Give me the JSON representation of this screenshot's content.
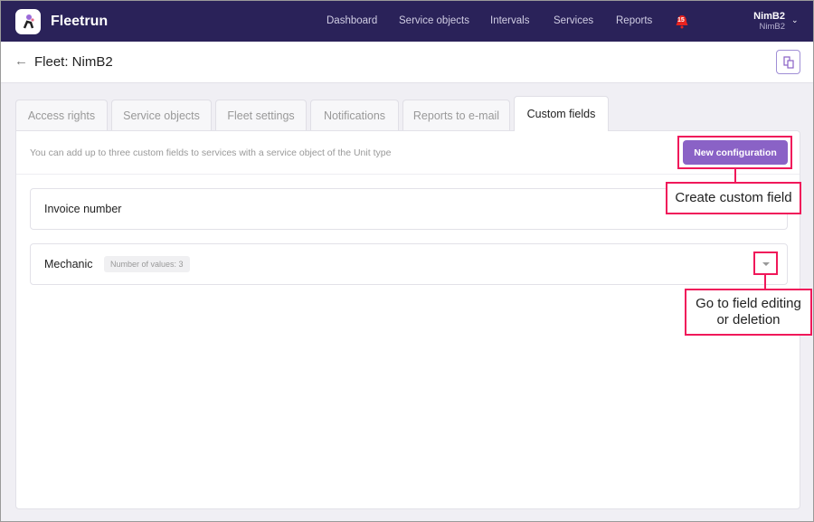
{
  "app": {
    "name": "Fleetrun"
  },
  "nav": [
    "Dashboard",
    "Service objects",
    "Intervals",
    "Services",
    "Reports"
  ],
  "notifications": {
    "count": "15"
  },
  "user": {
    "name": "NimB2",
    "account": "NimB2"
  },
  "page": {
    "title": "Fleet: NimB2"
  },
  "tabs": [
    "Access rights",
    "Service objects",
    "Fleet settings",
    "Notifications",
    "Reports to e-mail",
    "Custom fields"
  ],
  "active_tab": "Custom fields",
  "panel": {
    "hint": "You can add up to three custom fields to services with a service object of the Unit type",
    "new_button": "New configuration"
  },
  "fields": [
    {
      "name": "Invoice number"
    },
    {
      "name": "Mechanic",
      "badge": "Number of values: 3"
    }
  ],
  "annotations": {
    "create": "Create custom field",
    "edit_line1": "Go to field editing",
    "edit_line2": "or deletion"
  },
  "colors": {
    "header": "#2a2259",
    "accent": "#8a62c6",
    "annotation": "#f0185a"
  }
}
